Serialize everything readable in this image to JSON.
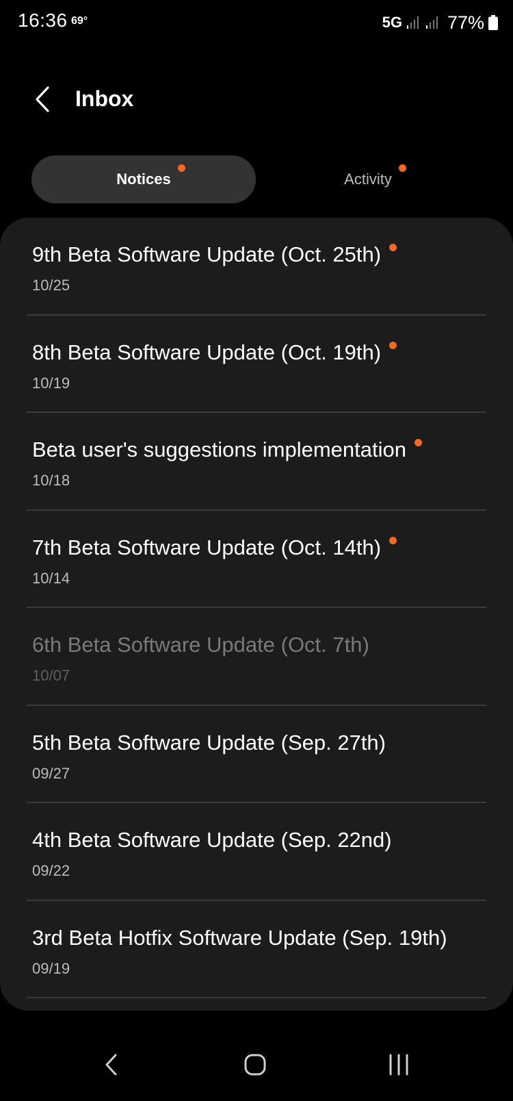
{
  "status_bar": {
    "time": "16:36",
    "temperature": "69°",
    "network": "5G",
    "battery": "77%"
  },
  "header": {
    "title": "Inbox"
  },
  "tabs": [
    {
      "label": "Notices",
      "selected": true,
      "has_unread_dot": true
    },
    {
      "label": "Activity",
      "selected": false,
      "has_unread_dot": true
    }
  ],
  "notices": [
    {
      "title": "9th Beta Software Update (Oct. 25th)",
      "date": "10/25",
      "unread": true
    },
    {
      "title": "8th Beta Software Update (Oct. 19th)",
      "date": "10/19",
      "unread": true
    },
    {
      "title": "Beta user's suggestions implementation",
      "date": "10/18",
      "unread": true
    },
    {
      "title": "7th Beta Software Update (Oct. 14th)",
      "date": "10/14",
      "unread": true
    },
    {
      "title": "6th Beta Software Update (Oct. 7th)",
      "date": "10/07",
      "unread": false,
      "dimmed": true
    },
    {
      "title": "5th Beta Software Update (Sep. 27th)",
      "date": "09/27",
      "unread": false
    },
    {
      "title": "4th Beta Software Update (Sep. 22nd)",
      "date": "09/22",
      "unread": false
    },
    {
      "title": "3rd Beta Hotfix Software Update (Sep. 19th)",
      "date": "09/19",
      "unread": false
    }
  ],
  "colors": {
    "accent_dot": "#f26a22",
    "background": "#000000",
    "card": "#1c1c1c",
    "tab_selected": "#333333"
  },
  "icons": {
    "back": "chevron-left-icon",
    "nav_back": "nav-back-icon",
    "nav_home": "nav-home-icon",
    "nav_recents": "nav-recents-icon"
  }
}
